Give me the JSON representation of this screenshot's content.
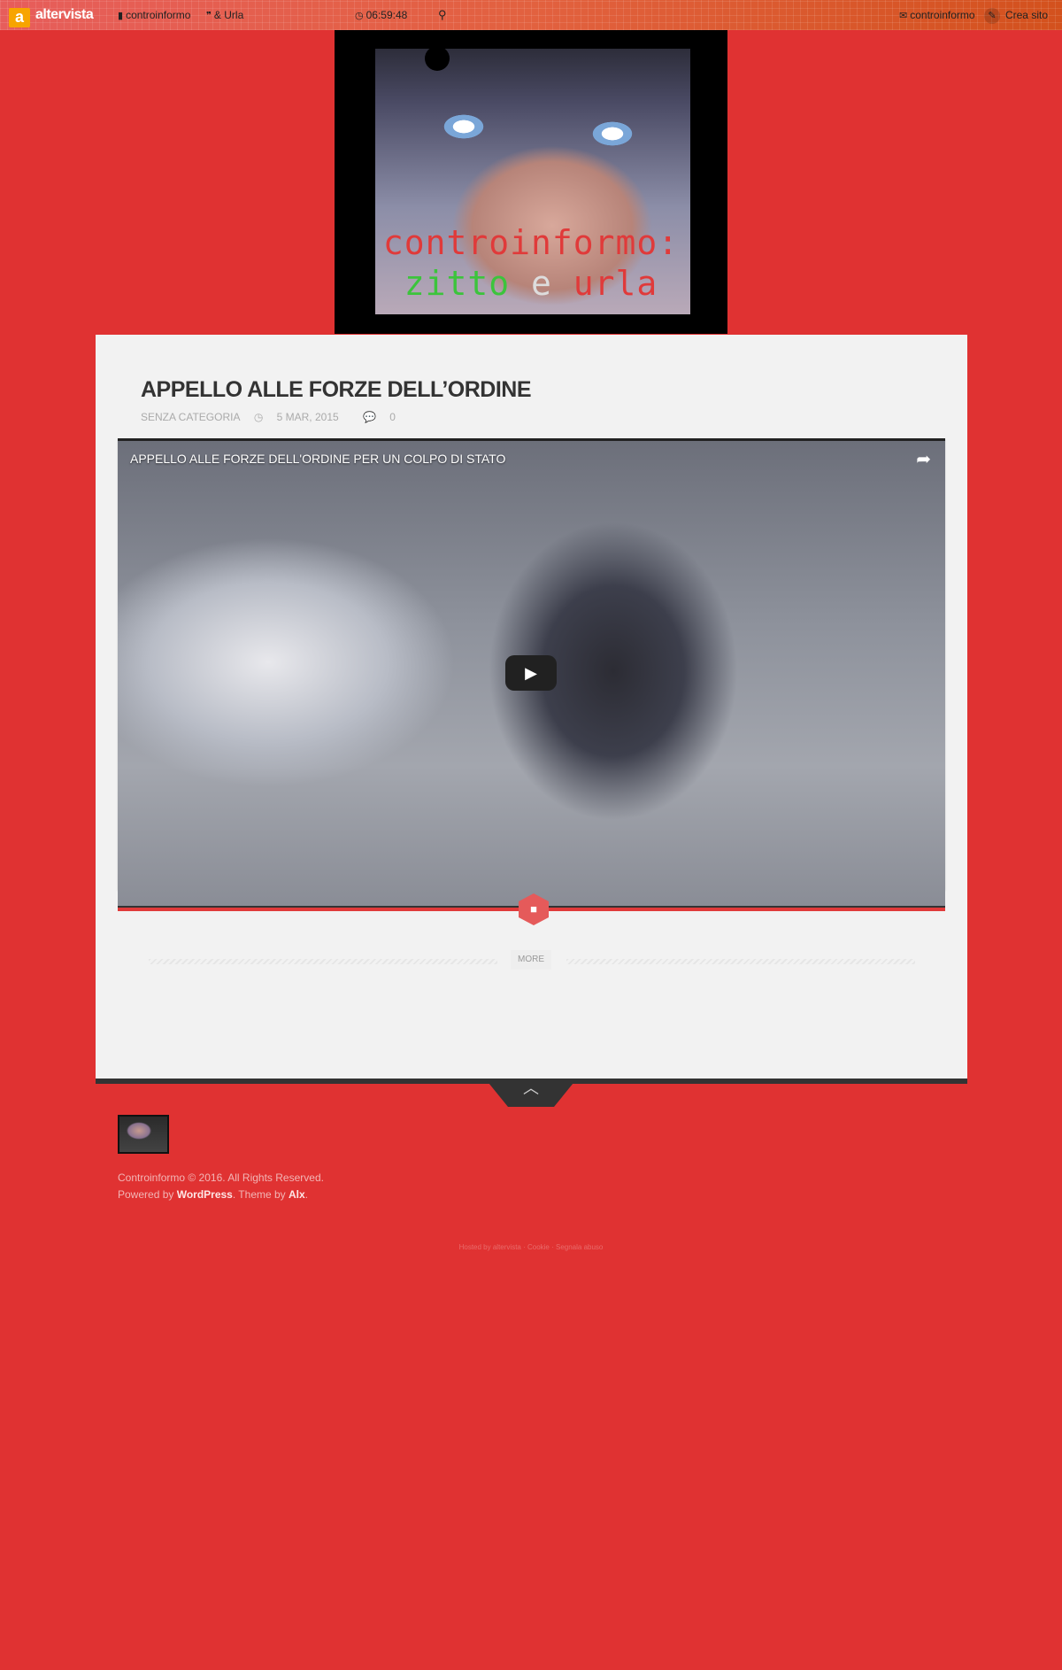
{
  "topbar": {
    "logo": "altervista",
    "logo_letter": "a",
    "site_link": "controinformo",
    "quote_link": "& Urla",
    "clock": "06:59:48",
    "contact_link": "controinformo",
    "create_site": "Crea sito"
  },
  "header": {
    "line1": "controinformo:",
    "line2_a": "zitto",
    "line2_b": "e",
    "line2_c": "urla"
  },
  "post": {
    "title": "APPELLO ALLE FORZE DELL’ORDINE",
    "category": "SENZA CATEGORIA",
    "date": "5 MAR, 2015",
    "comments": "0",
    "video_title": "APPELLO ALLE FORZE DELL'ORDINE PER UN COLPO DI STATO",
    "more_label": "MORE"
  },
  "footer": {
    "copyright": "Controinformo © 2016. All Rights Reserved.",
    "powered_prefix": "Powered by",
    "powered_link": "WordPress",
    "theme_prefix": ". Theme by",
    "theme_link": "Alx",
    "period": ".",
    "altervista_links": "Hosted by altervista · Cookie · Segnala abuso"
  },
  "colors": {
    "background": "#e03232",
    "content": "#f2f2f2",
    "accent": "#e55a5a"
  }
}
